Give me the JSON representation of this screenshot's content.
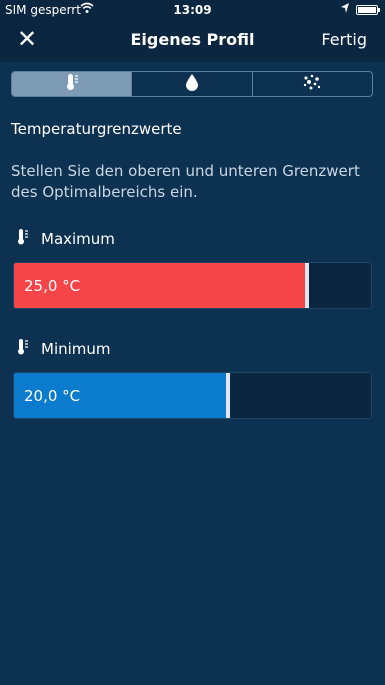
{
  "status_bar": {
    "carrier": "SIM gesperrt",
    "time": "13:09"
  },
  "nav": {
    "title": "Eigenes Profil",
    "done_label": "Fertig",
    "close_icon": "close-icon"
  },
  "tabs": [
    {
      "icon": "thermometer-icon",
      "active": true
    },
    {
      "icon": "water-drop-icon",
      "active": false
    },
    {
      "icon": "particles-icon",
      "active": false
    }
  ],
  "section": {
    "title": "Temperaturgrenzwerte",
    "description": "Stellen Sie den oberen und unteren Grenzwert des Optimalbereichs ein."
  },
  "limits": {
    "maximum": {
      "label": "Maximum",
      "value_text": "25,0 °C",
      "level_fraction": 0.82,
      "color": "#f64548"
    },
    "minimum": {
      "label": "Minimum",
      "value_text": "20,0 °C",
      "level_fraction": 0.6,
      "color": "#0a7bcd"
    }
  },
  "colors": {
    "background": "#0d3150",
    "navbar": "#0a2640",
    "segment_active": "#7d9bb5"
  }
}
